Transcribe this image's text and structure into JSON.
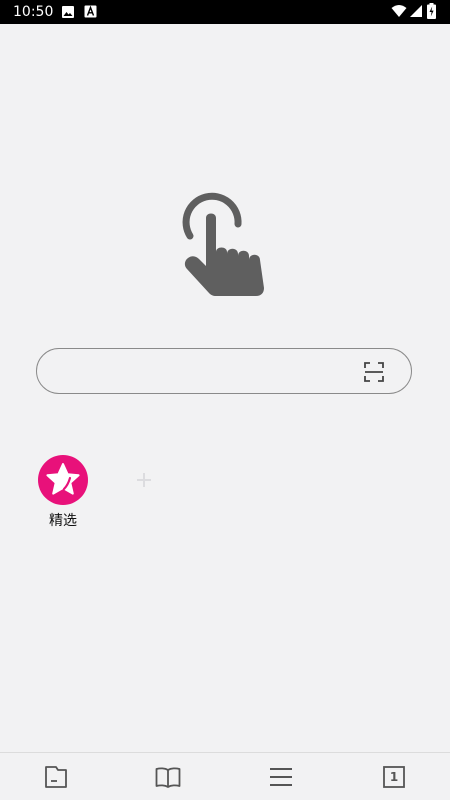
{
  "status_bar": {
    "time": "10:50"
  },
  "search": {
    "value": "",
    "placeholder": ""
  },
  "shortcuts": [
    {
      "label": "精选",
      "icon": "star-icon",
      "color": "#e8117a"
    }
  ],
  "toolbar": {
    "tab_count": "1"
  },
  "colors": {
    "background": "#f2f2f3",
    "icon_gray": "#5f5f5f",
    "accent_pink": "#e8117a"
  }
}
